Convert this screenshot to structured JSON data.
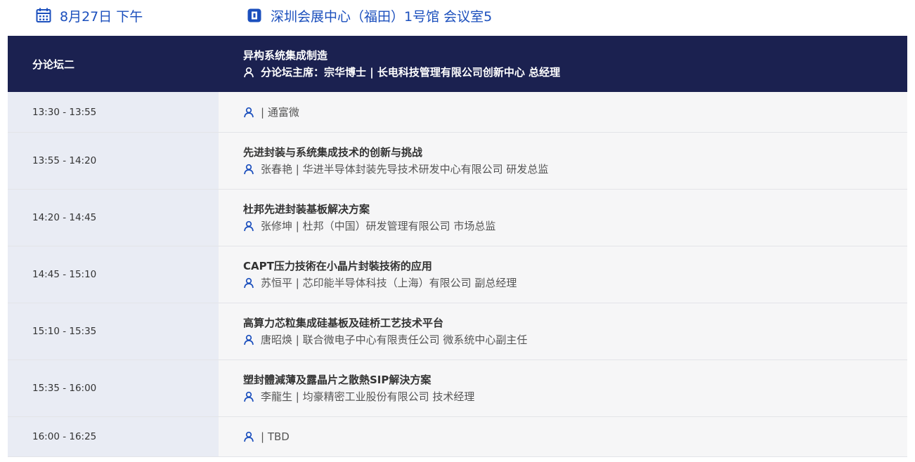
{
  "header": {
    "date": "8月27日 下午",
    "venue": "深圳会展中心（福田）1号馆 会议室5"
  },
  "forum": {
    "name": "分论坛二",
    "theme": "异构系统集成制造",
    "chair": "分论坛主席：宗华博士 | 长电科技管理有限公司创新中心 总经理"
  },
  "sessions": [
    {
      "time": "13:30 - 13:55",
      "title": "",
      "speaker": "| 通富微"
    },
    {
      "time": "13:55 - 14:20",
      "title": "先进封装与系统集成技术的创新与挑战",
      "speaker": "张春艳 | 华进半导体封装先导技术研发中心有限公司 研发总监"
    },
    {
      "time": "14:20 - 14:45",
      "title": "杜邦先进封装基板解决方案",
      "speaker": "张修坤 | 杜邦（中国）研发管理有限公司 市场总监"
    },
    {
      "time": "14:45 - 15:10",
      "title": "CAPT压力技術在小晶片封裝技術的应用",
      "speaker": "苏恒平 | 芯印能半导体科技（上海）有限公司 副总经理"
    },
    {
      "time": "15:10 - 15:35",
      "title": "高算力芯粒集成硅基板及硅桥工艺技术平台",
      "speaker": "唐昭焕 | 联合微电子中心有限责任公司 微系统中心副主任"
    },
    {
      "time": "15:35 - 16:00",
      "title": "塑封體減薄及露晶片之散熱SIP解決方案",
      "speaker": "李龍生 | 均豪精密工业股份有限公司 技术经理"
    },
    {
      "time": "16:00 - 16:25",
      "title": "",
      "speaker": "| TBD"
    }
  ],
  "colors": {
    "accent": "#1b4fbd",
    "header_bg": "#1b2150",
    "time_bg": "#e9ecf4",
    "content_bg": "#f6f6f7"
  },
  "icons": {
    "date": "calendar-icon",
    "venue": "venue-icon",
    "person": "person-icon"
  }
}
